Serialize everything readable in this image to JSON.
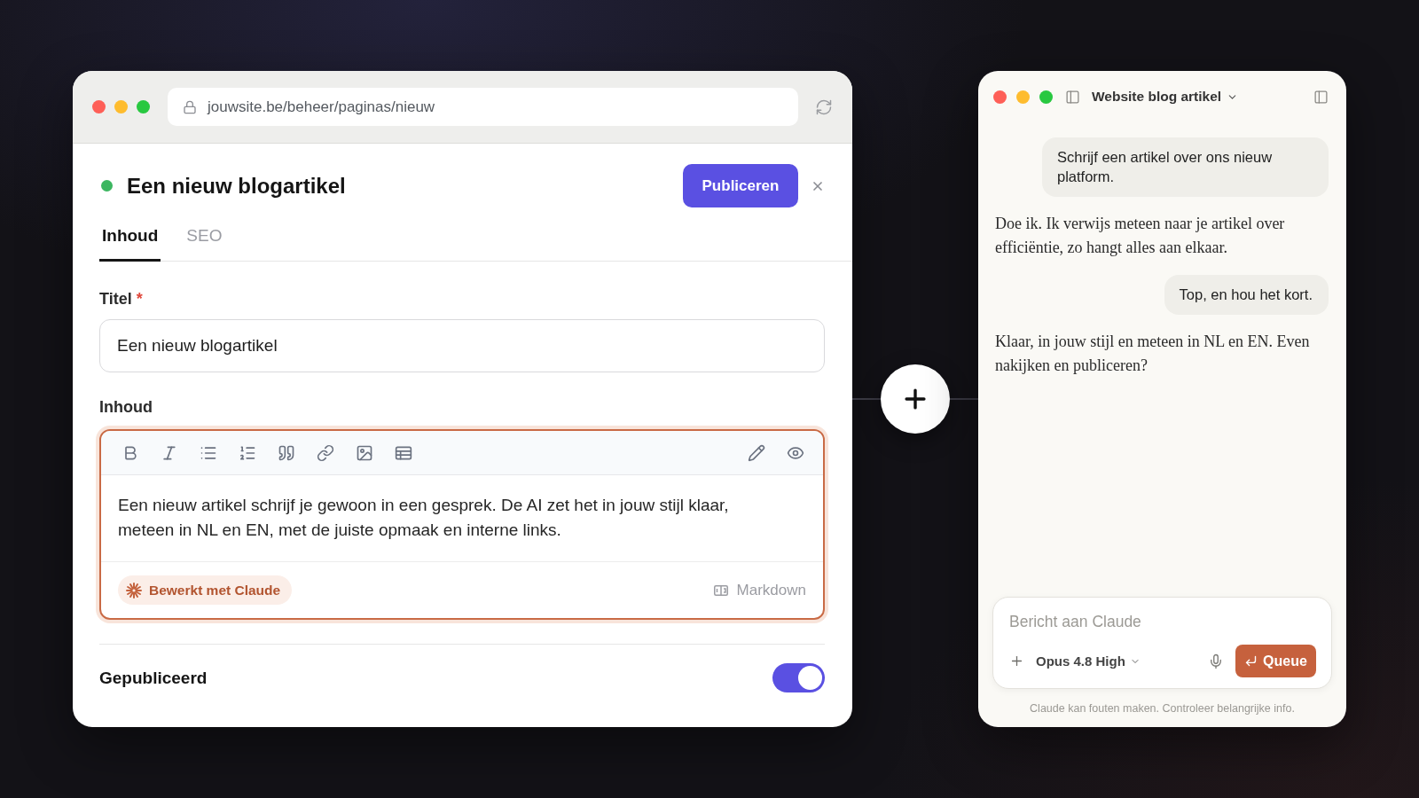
{
  "browser": {
    "url": "jouwsite.be/beheer/paginas/nieuw"
  },
  "page": {
    "status_active": true,
    "title": "Een nieuw blogartikel",
    "publish_button": "Publiceren"
  },
  "tabs": [
    {
      "label": "Inhoud",
      "selected": true
    },
    {
      "label": "SEO",
      "selected": false
    }
  ],
  "title_field": {
    "label": "Titel",
    "required_mark": "*",
    "value": "Een nieuw blogartikel"
  },
  "content_field": {
    "label": "Inhoud",
    "focused": true,
    "text": "Een nieuw artikel schrijf je gewoon in een gesprek. De AI zet het in jouw stijl klaar, meteen in NL en EN, met de juiste opmaak en interne links.",
    "badge": "Bewerkt met Claude",
    "mode": "Markdown"
  },
  "published": {
    "label": "Gepubliceerd",
    "on": true
  },
  "chat": {
    "title": "Website blog artikel",
    "messages": [
      {
        "kind": "user",
        "text": "Schrijf een artikel over ons nieuw platform."
      },
      {
        "kind": "assistant",
        "text": "Doe ik. Ik verwijs meteen naar je artikel over efficiëntie, zo hangt alles aan elkaar."
      },
      {
        "kind": "user",
        "text": "Top, en hou het kort."
      },
      {
        "kind": "assistant",
        "text": "Klaar, in jouw stijl en meteen in NL en EN. Even nakijken en publiceren?"
      }
    ],
    "composer": {
      "placeholder": "Bericht aan Claude",
      "model": "Opus 4.8 High",
      "send_button": "Queue"
    },
    "disclaimer": "Claude kan fouten maken. Controleer belangrijke info."
  }
}
